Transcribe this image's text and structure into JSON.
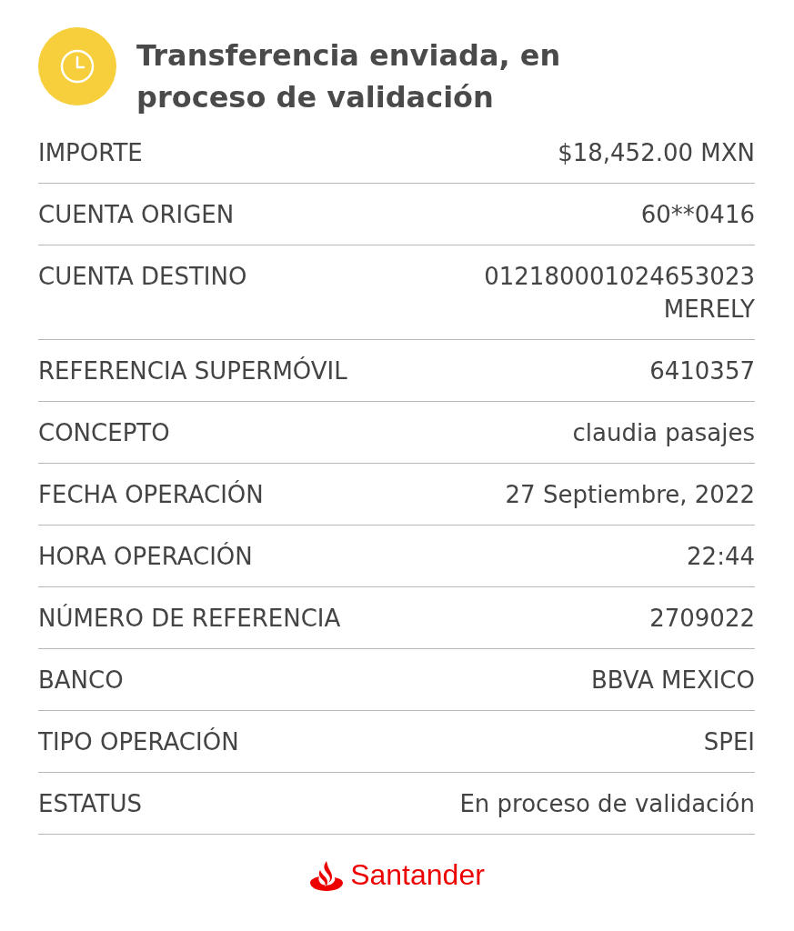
{
  "header": {
    "title": "Transferencia enviada, en proceso de validación"
  },
  "details": [
    {
      "label": "IMPORTE",
      "value": [
        "$18,452.00 MXN"
      ]
    },
    {
      "label": "CUENTA ORIGEN",
      "value": [
        "60**0416"
      ]
    },
    {
      "label": "CUENTA DESTINO",
      "value": [
        "012180001024653023",
        "MERELY"
      ]
    },
    {
      "label": "REFERENCIA SUPERMÓVIL",
      "value": [
        "6410357"
      ]
    },
    {
      "label": "CONCEPTO",
      "value": [
        "claudia pasajes"
      ]
    },
    {
      "label": "FECHA OPERACIÓN",
      "value": [
        "27 Septiembre, 2022"
      ]
    },
    {
      "label": "HORA OPERACIÓN",
      "value": [
        "22:44"
      ]
    },
    {
      "label": "NÚMERO DE REFERENCIA",
      "value": [
        "2709022"
      ]
    },
    {
      "label": "BANCO",
      "value": [
        "BBVA MEXICO"
      ]
    },
    {
      "label": "TIPO OPERACIÓN",
      "value": [
        "SPEI"
      ]
    },
    {
      "label": "ESTATUS",
      "value": [
        "En proceso de validación"
      ]
    }
  ],
  "footer": {
    "brand": "Santander"
  }
}
